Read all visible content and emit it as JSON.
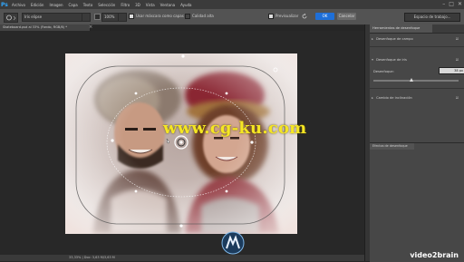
{
  "app": {
    "logo": "Ps"
  },
  "menu": [
    "Archivo",
    "Edición",
    "Imagen",
    "Capa",
    "Texto",
    "Selección",
    "Filtro",
    "3D",
    "Vista",
    "Ventana",
    "Ayuda"
  ],
  "window_controls": [
    "–",
    "□",
    "✕"
  ],
  "options": {
    "preset_value": "Iris elipse",
    "opacity_value": "100%",
    "check1_label": "Usar máscara como capas",
    "check2_label": "Calidad alta",
    "check3_label": "Previsualizar",
    "ok_label": "OK",
    "cancel_label": "Cancelar",
    "workspace_label": "Espacio de trabajo..."
  },
  "document": {
    "tab_title": "Skateboard.psd al 33% (Fondo, RGB/8) *",
    "close": "×",
    "status": "33,33% | Doc: 3,63 M/3,63 M"
  },
  "watermark": "www.cg-ku.com",
  "panel": {
    "tab_label": "Herramientas de desenfoque",
    "rows": [
      {
        "label": "Desenfoque de campo",
        "expanded": false,
        "checked": true
      },
      {
        "label": "Desenfoque de iris",
        "expanded": true,
        "checked": true
      },
      {
        "label": "Cambio de inclinación",
        "expanded": false,
        "checked": true
      }
    ],
    "blur_label": "Desenfoque:",
    "blur_value": "38 px",
    "blur_level": 0.45,
    "lower_tab_label": "Efectos de desenfoque"
  },
  "branding": {
    "corner_logo": "video2brain"
  },
  "colors": {
    "accent": "#1e6fd8",
    "watermark": "#f5e623"
  }
}
